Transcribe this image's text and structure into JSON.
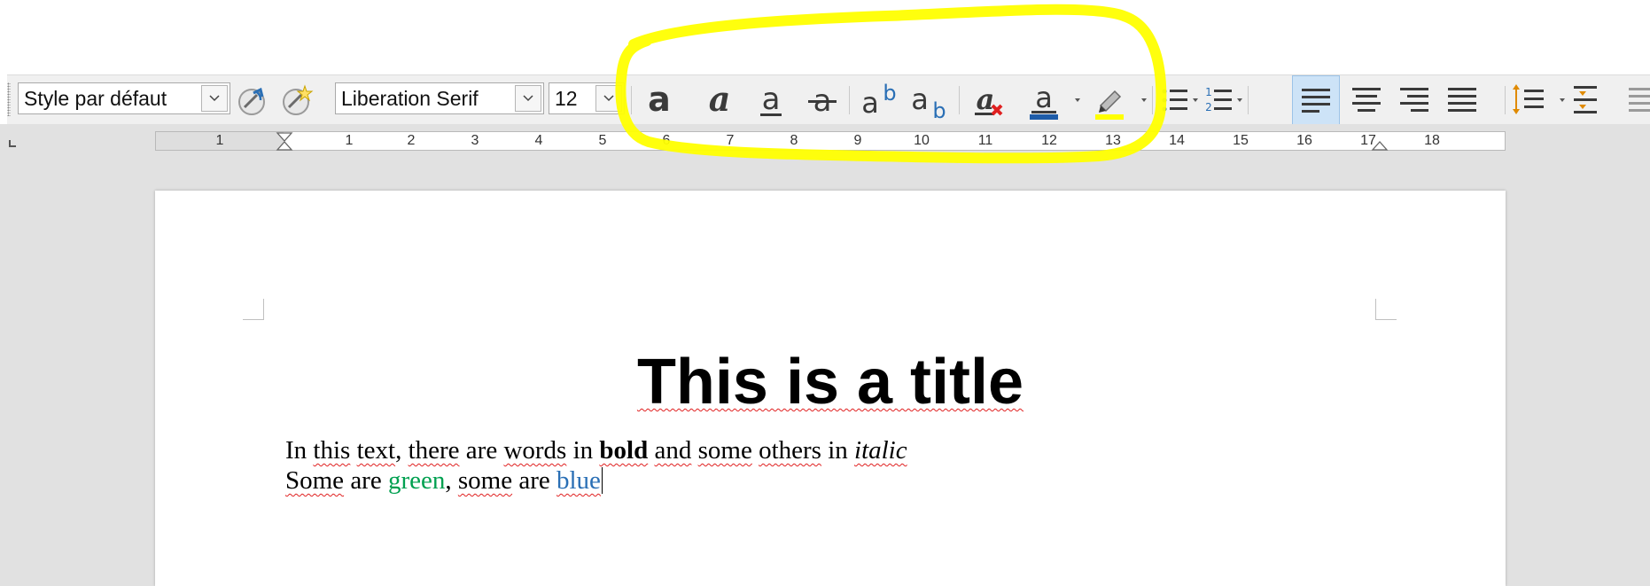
{
  "toolbar": {
    "paragraph_style": "Style par défaut",
    "font_name": "Liberation Serif",
    "font_size": "12",
    "buttons": [
      "update-style",
      "new-style",
      "bold",
      "italic",
      "underline",
      "strikethrough",
      "superscript",
      "subscript",
      "clear-formatting",
      "font-color",
      "highlighting",
      "bullets",
      "numbering",
      "align-left",
      "align-center",
      "align-right",
      "justified",
      "line-spacing",
      "paragraph-spacing"
    ],
    "active_button": "align-left",
    "glyphs": {
      "bold": "a",
      "italic": "a",
      "underline": "a",
      "strikethrough": "a",
      "superscript_base": "a",
      "superscript_mark": "b",
      "subscript_base": "a",
      "subscript_mark": "b",
      "clear": "a",
      "font_color": "a",
      "numbering_1": "1",
      "numbering_2": "2"
    },
    "colors": {
      "font_color": "#1e5ca8",
      "highlight": "#ffff00",
      "active_bg": "#cde3f7",
      "icon": "#3a3a3a"
    }
  },
  "ruler": {
    "numbers": [
      "1",
      "1",
      "2",
      "3",
      "4",
      "5",
      "6",
      "7",
      "8",
      "9",
      "10",
      "11",
      "12",
      "13",
      "14",
      "15",
      "16",
      "17",
      "18"
    ],
    "units": "cm"
  },
  "document": {
    "title": "This is a title",
    "line1": {
      "w1": "In",
      "w2": "this",
      "w3": "text",
      "p1": ",",
      "w4": "there",
      "w5": "are",
      "w6": "words",
      "w7": "in",
      "bold": "bold",
      "w8": "and",
      "w9": "some",
      "w10": "others",
      "w11": "in",
      "italic": "italic"
    },
    "line2": {
      "w1": "Some",
      "w2": "are",
      "green": "green",
      "p1": ",",
      "w3": "some",
      "w4": "are",
      "blue": "blue"
    },
    "colors": {
      "green": "#00a050",
      "blue": "#2a6fb5"
    }
  },
  "annotation": {
    "highlight_color": "#ffff00"
  }
}
